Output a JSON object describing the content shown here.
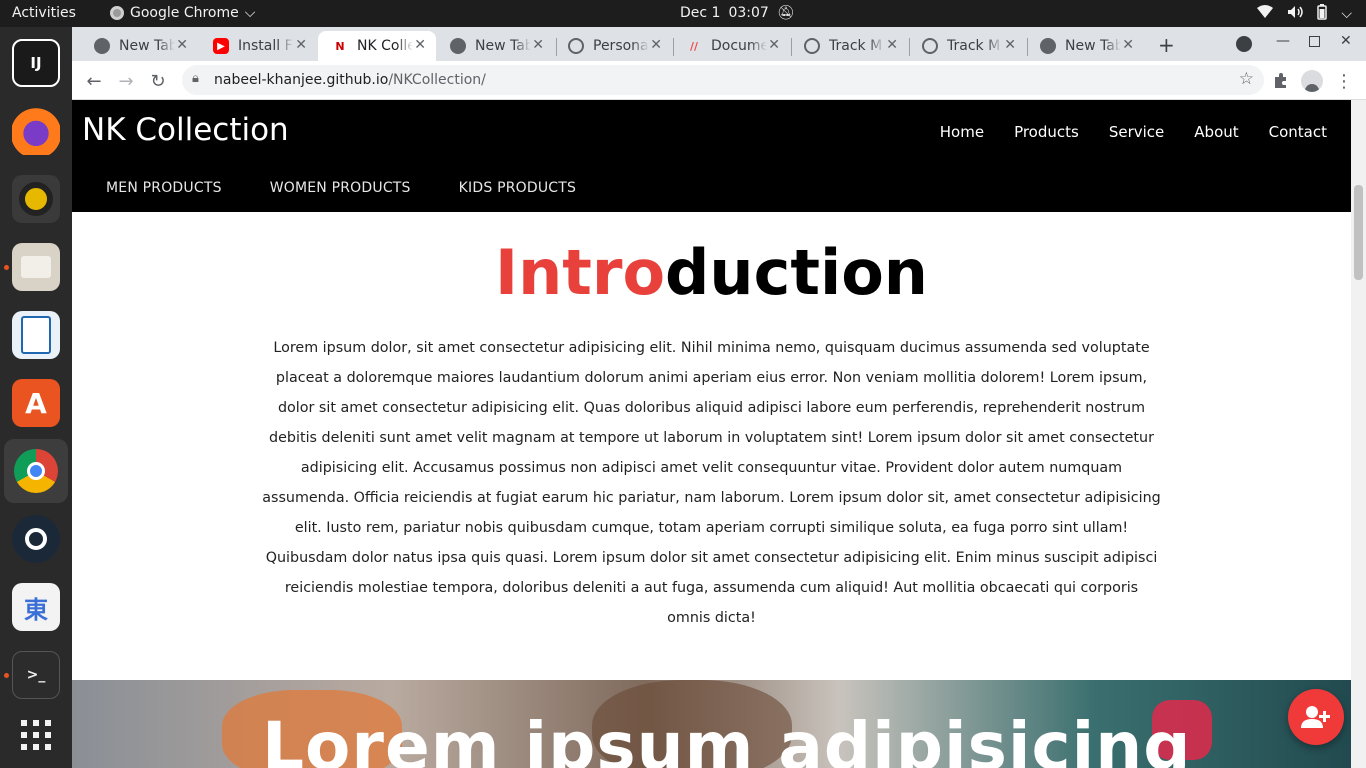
{
  "system": {
    "activities": "Activities",
    "app_name": "Google Chrome",
    "date": "Dec 1",
    "time": "03:07"
  },
  "dock": {
    "items": [
      {
        "name": "intellij-icon",
        "label": "IJ"
      },
      {
        "name": "firefox-icon",
        "label": ""
      },
      {
        "name": "rhythmbox-icon",
        "label": ""
      },
      {
        "name": "files-icon",
        "label": ""
      },
      {
        "name": "libreoffice-writer-icon",
        "label": ""
      },
      {
        "name": "software-center-icon",
        "label": "A"
      },
      {
        "name": "chrome-icon",
        "label": ""
      },
      {
        "name": "steam-icon",
        "label": ""
      },
      {
        "name": "input-method-icon",
        "label": "東"
      },
      {
        "name": "terminal-icon",
        "label": ">_"
      },
      {
        "name": "show-apps-icon",
        "label": ""
      }
    ]
  },
  "browser": {
    "tabs": [
      {
        "title": "New Tab",
        "icon": "chrome-favicon"
      },
      {
        "title": "Install F",
        "icon": "youtube-favicon"
      },
      {
        "title": "NK Colle",
        "icon": "nk-favicon",
        "active": true
      },
      {
        "title": "New Tab",
        "icon": "chrome-favicon"
      },
      {
        "title": "Persona",
        "icon": "globe-favicon"
      },
      {
        "title": "Docume",
        "icon": "docs-favicon"
      },
      {
        "title": "Track M",
        "icon": "globe-favicon"
      },
      {
        "title": "Track M",
        "icon": "globe-favicon"
      },
      {
        "title": "New Tab",
        "icon": "chrome-favicon"
      }
    ],
    "url_host": "nabeel-khanjee.github.io",
    "url_path": "/NKCollection/"
  },
  "page": {
    "brand": "NK Collection",
    "main_nav": [
      "Home",
      "Products",
      "Service",
      "About",
      "Contact"
    ],
    "sub_nav": [
      "MEN PRODUCTS",
      "WOMEN PRODUCTS",
      "KIDS PRODUCTS"
    ],
    "intro_title_red": "Intro",
    "intro_title_rest": "duction",
    "intro_text": "Lorem ipsum dolor, sit amet consectetur adipisicing elit. Nihil minima nemo, quisquam ducimus assumenda sed voluptate placeat a doloremque maiores laudantium dolorum animi aperiam eius error. Non veniam mollitia dolorem! Lorem ipsum, dolor sit amet consectetur adipisicing elit. Quas doloribus aliquid adipisci labore eum perferendis, reprehenderit nostrum debitis deleniti sunt amet velit magnam at tempore ut laborum in voluptatem sint! Lorem ipsum dolor sit amet consectetur adipisicing elit. Accusamus possimus non adipisci amet velit consequuntur vitae. Provident dolor autem numquam assumenda. Officia reiciendis at fugiat earum hic pariatur, nam laborum. Lorem ipsum dolor sit, amet consectetur adipisicing elit. Iusto rem, pariatur nobis quibusdam cumque, totam aperiam corrupti similique soluta, ea fuga porro sint ullam! Quibusdam dolor natus ipsa quis quasi. Lorem ipsum dolor sit amet consectetur adipisicing elit. Enim minus suscipit adipisci reiciendis molestiae tempora, doloribus deleniti a aut fuga, assumenda cum aliquid! Aut mollitia obcaecati qui corporis omnis dicta!",
    "hero_title": "Lorem ipsum adipisicing",
    "accent_color": "#e8403a",
    "fab_icon": "add-user-icon"
  }
}
